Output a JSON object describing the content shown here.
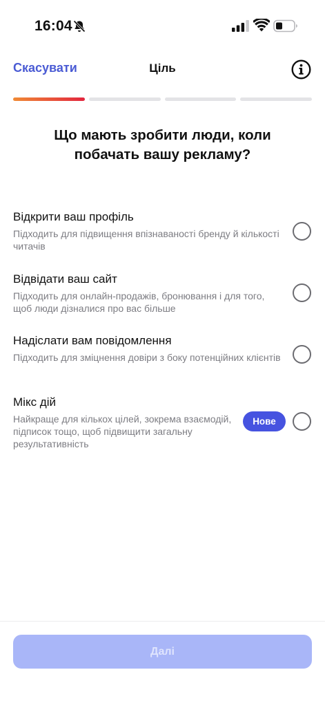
{
  "status_bar": {
    "time": "16:04"
  },
  "nav": {
    "cancel_label": "Скасувати",
    "title": "Ціль"
  },
  "progress": {
    "total_steps": 4,
    "current_step": 1
  },
  "question": "Що мають зробити люди, коли побачать вашу рекламу?",
  "options": [
    {
      "title": "Відкрити ваш профіль",
      "description": "Підходить для підвищення впізнаваності бренду й кількості читачів"
    },
    {
      "title": "Відвідати ваш сайт",
      "description": "Підходить для онлайн-продажів, бронювання і для того, щоб люди дізналися про вас більше"
    },
    {
      "title": "Надіслати вам повідомлення",
      "description": "Підходить для зміцнення довіри з боку потенційних клієнтів"
    },
    {
      "title": "Мікс дій",
      "description": "Найкраще для кількох цілей, зокрема взаємодій, підписок тощо, щоб підвищити загальну результативність",
      "badge": "Нове"
    }
  ],
  "footer": {
    "next_label": "Далі"
  },
  "colors": {
    "accent": "#4a5bd4",
    "badge": "#4653e0",
    "progress_gradient_start": "#f08a35",
    "progress_gradient_end": "#e2263e",
    "next_disabled": "#a9b6f8"
  },
  "icons": {
    "status": [
      "bell-muted-icon",
      "signal-icon",
      "wifi-icon",
      "battery-icon"
    ],
    "info": "info-icon"
  }
}
